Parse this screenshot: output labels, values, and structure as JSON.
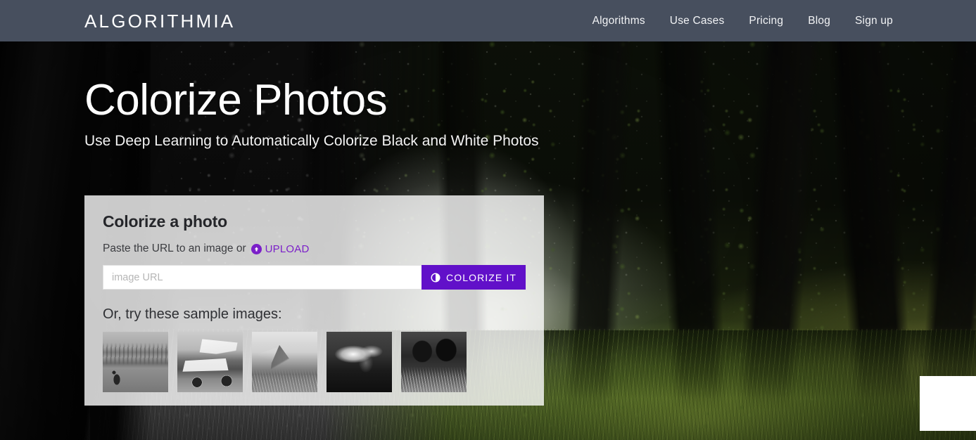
{
  "header": {
    "logo": "ALGORITHMIA",
    "nav": [
      {
        "label": "Algorithms"
      },
      {
        "label": "Use Cases"
      },
      {
        "label": "Pricing"
      },
      {
        "label": "Blog"
      },
      {
        "label": "Sign up"
      }
    ]
  },
  "hero": {
    "title": "Colorize Photos",
    "subtitle": "Use Deep Learning to Automatically Colorize Black and White Photos"
  },
  "card": {
    "title": "Colorize a photo",
    "instruction": "Paste the URL to an image or",
    "upload_label": "UPLOAD",
    "upload_icon": "upload-circle-icon",
    "input_placeholder": "image URL",
    "input_value": "",
    "button_label": "COLORIZE IT",
    "button_icon": "contrast-circle-icon",
    "samples_label": "Or, try these sample images:",
    "samples": [
      {
        "alt": "shore bird on beach"
      },
      {
        "alt": "sprint race car"
      },
      {
        "alt": "rocky mountain peak"
      },
      {
        "alt": "dark scene with smoke"
      },
      {
        "alt": "cows in grass"
      }
    ]
  },
  "colors": {
    "header_bg": "#474f5e",
    "accent_purple": "#6110c9",
    "link_purple": "#7b1fc9",
    "card_bg": "rgba(252,252,252,0.80)"
  }
}
